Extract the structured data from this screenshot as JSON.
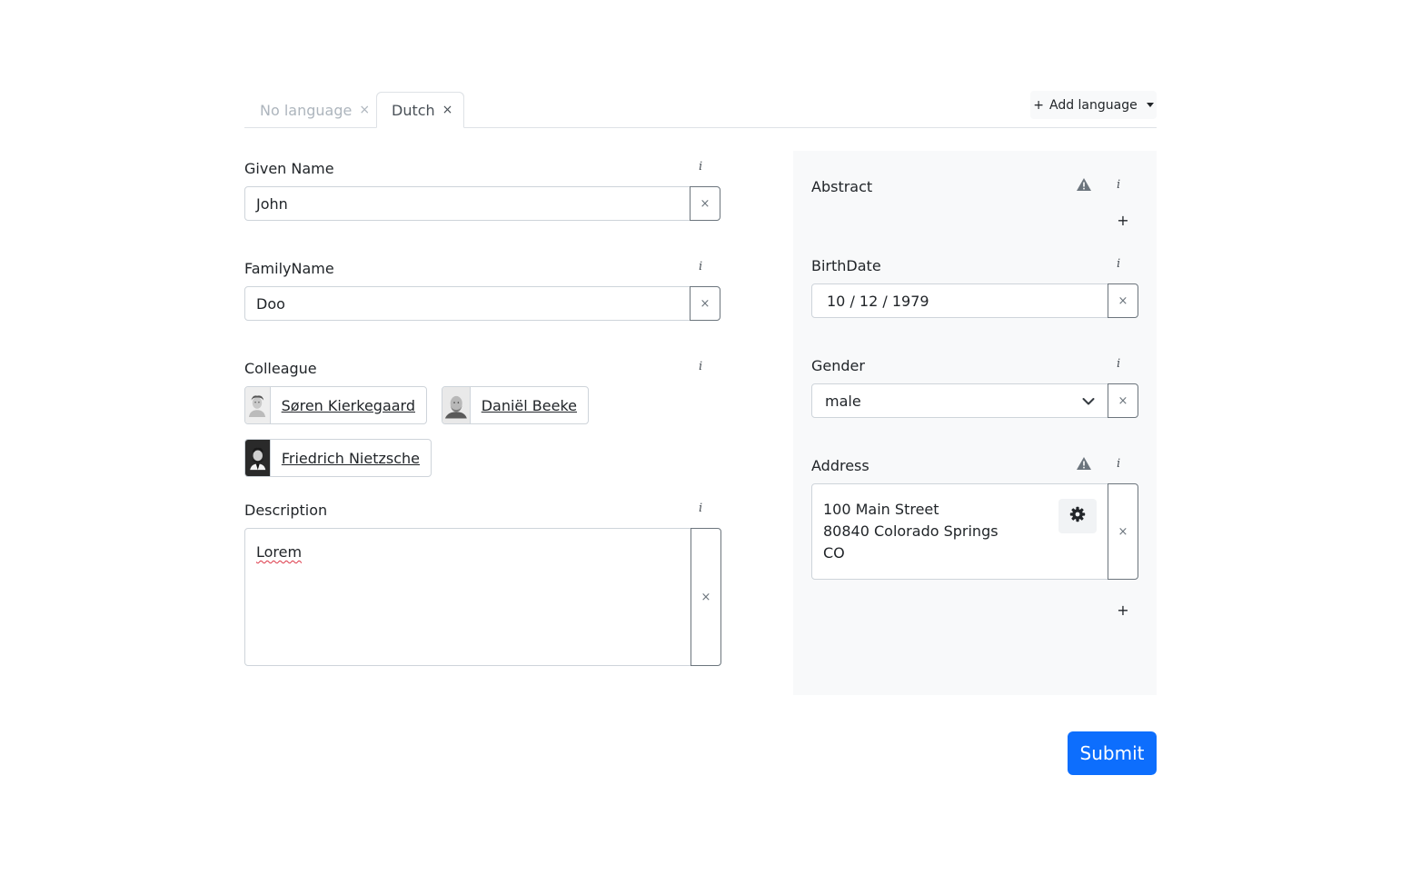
{
  "tabs": [
    {
      "label": "No language",
      "close": "×"
    },
    {
      "label": "Dutch",
      "close": "×"
    }
  ],
  "add_language": {
    "icon": "+",
    "label": "Add language"
  },
  "info_glyph": "i",
  "clear_glyph": "×",
  "given_name": {
    "label": "Given Name",
    "value": "John"
  },
  "family_name": {
    "label": "FamilyName",
    "value": "Doo"
  },
  "colleague": {
    "label": "Colleague",
    "items": [
      {
        "name": "Søren Kierkegaard"
      },
      {
        "name": "Daniël Beeke"
      },
      {
        "name": "Friedrich Nietzsche"
      }
    ]
  },
  "description": {
    "label": "Description",
    "value": "Lorem"
  },
  "abstract": {
    "label": "Abstract",
    "add": "+"
  },
  "birth_date": {
    "label": "BirthDate",
    "value": "10 / 12 / 1979"
  },
  "gender": {
    "label": "Gender",
    "value": "male"
  },
  "address": {
    "label": "Address",
    "lines": [
      "100 Main Street",
      "80840 Colorado Springs",
      "CO"
    ],
    "add": "+"
  },
  "submit": {
    "label": "Submit"
  },
  "colors": {
    "primary": "#0d6efd",
    "panel": "#f8f9fa",
    "border": "#ced4da"
  }
}
